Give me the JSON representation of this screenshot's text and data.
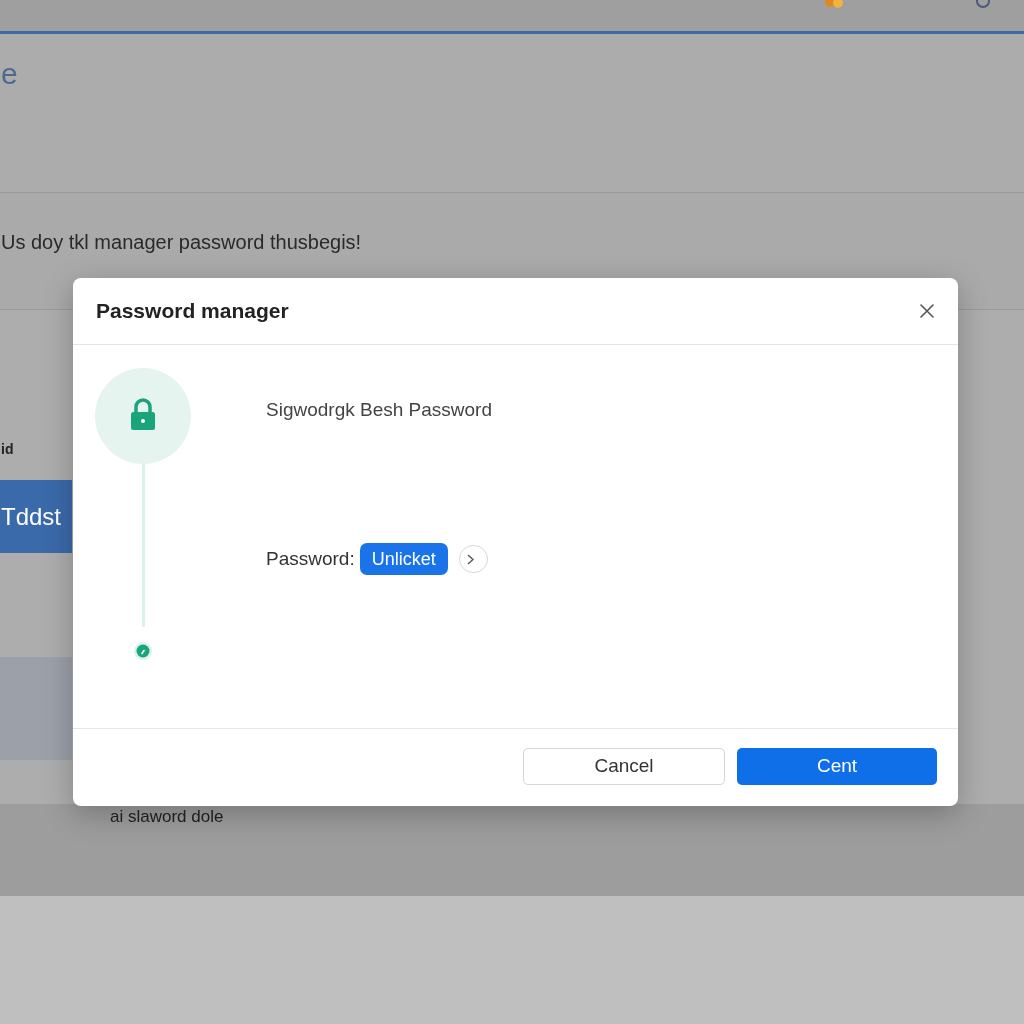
{
  "page": {
    "heading": "e",
    "notice": "Us doy tkl manager password thusbegis!",
    "side_label": "id",
    "side_button": "Tddst",
    "footer_text": "ai slaword dole"
  },
  "dialog": {
    "title": "Password manager",
    "steps": [
      {
        "kind": "lock"
      },
      {
        "kind": "marker"
      }
    ],
    "prompt": "Sigwodrgk Besh Password",
    "password_label": "Password:",
    "unlock_button": "Unlicket",
    "buttons": [
      {
        "label": "Cancel",
        "kind": "secondary"
      },
      {
        "label": "Cent",
        "kind": "primary"
      }
    ]
  }
}
